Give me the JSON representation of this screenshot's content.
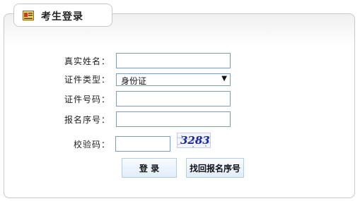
{
  "header": {
    "title": "考生登录",
    "icon": "login-card-icon"
  },
  "form": {
    "name_label": "真实姓名：",
    "name_value": "",
    "id_type_label": "证件类型：",
    "id_type_value": "身份证",
    "id_no_label": "证件号码：",
    "id_no_value": "",
    "reg_no_label": "报名序号：",
    "reg_no_value": "",
    "captcha_label": "校验码：",
    "captcha_value": "",
    "captcha_image_text": "3283"
  },
  "buttons": {
    "login": "登 录",
    "recover": "找回报名序号"
  }
}
